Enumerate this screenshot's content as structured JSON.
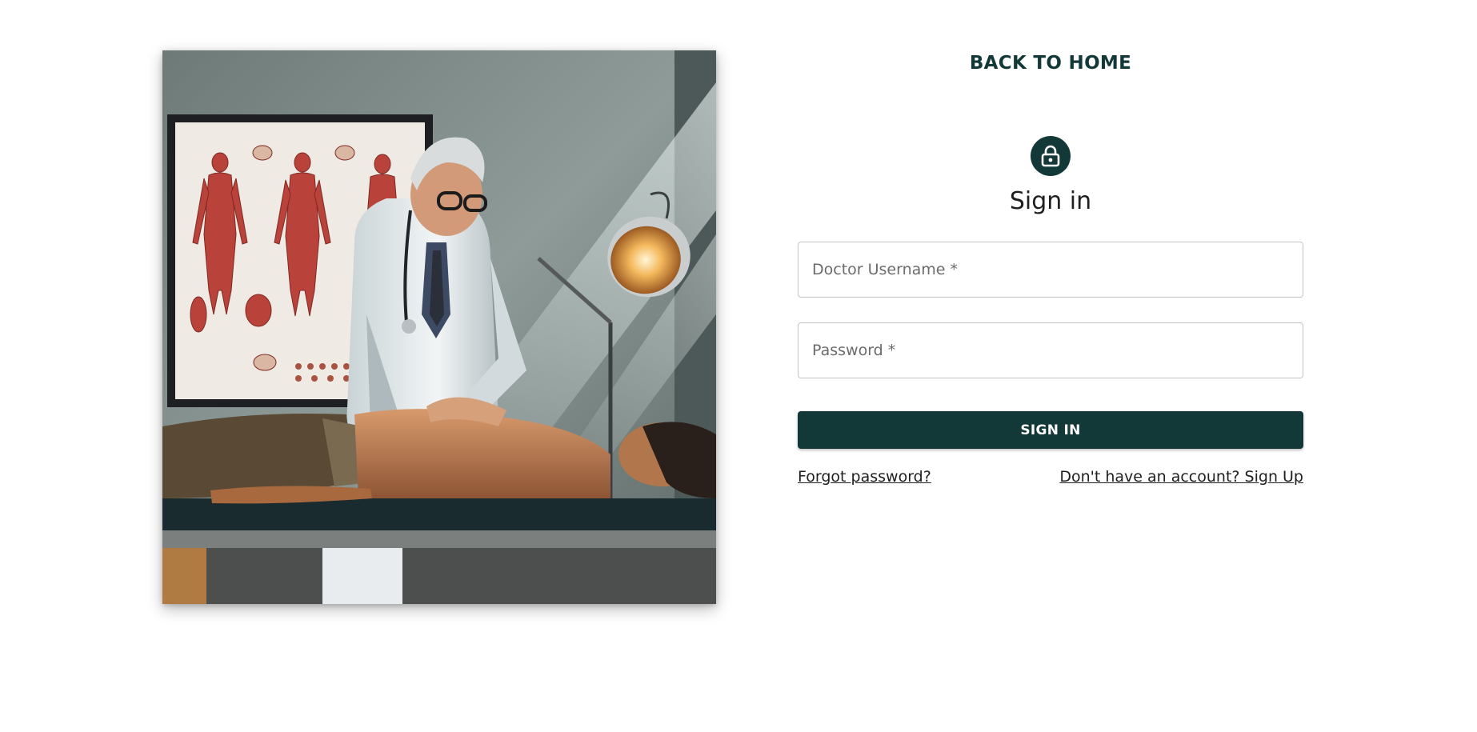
{
  "header": {
    "back_home_label": "BACK TO HOME"
  },
  "hero": {
    "image_description_icon": "doctor-examining-patient-image"
  },
  "form": {
    "lock_icon": "lock-icon",
    "title": "Sign in",
    "username": {
      "placeholder": "Doctor Username *",
      "value": ""
    },
    "password": {
      "placeholder": "Password *",
      "value": ""
    },
    "submit_label": "SIGN IN",
    "forgot_password_label": "Forgot password?",
    "signup_label": "Don't have an account? Sign Up"
  },
  "colors": {
    "primary": "#123838",
    "background": "#ffffff",
    "field_border": "#c4c4c4",
    "text": "#1f1f1f"
  }
}
